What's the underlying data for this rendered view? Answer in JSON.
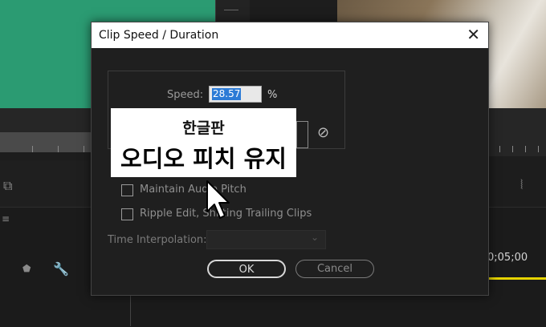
{
  "dialog": {
    "title": "Clip Speed / Duration",
    "close_glyph": "✕",
    "speed_label": "Speed:",
    "speed_value": "28.57",
    "speed_unit": "%",
    "maintain_audio_pitch_label": "Maintain Audio Pitch",
    "maintain_audio_pitch_checked": false,
    "ripple_edit_label": "Ripple Edit, Shifting Trailing Clips",
    "ripple_edit_checked": false,
    "time_interpolation_label": "Time Interpolation:",
    "time_interpolation_value": "",
    "ok_label": "OK",
    "cancel_label": "Cancel"
  },
  "overlay": {
    "line1": "한글판",
    "line2": "오디오 피치 유지"
  },
  "timeline": {
    "timecode": "0;05;00",
    "playhead_color": "#e6d400"
  },
  "icons": {
    "link": "link-icon",
    "close": "close-icon",
    "cursor": "mouse-pointer-icon"
  },
  "colors": {
    "accent_selection": "#2c7bd6",
    "green_clip": "#2b9b72"
  }
}
